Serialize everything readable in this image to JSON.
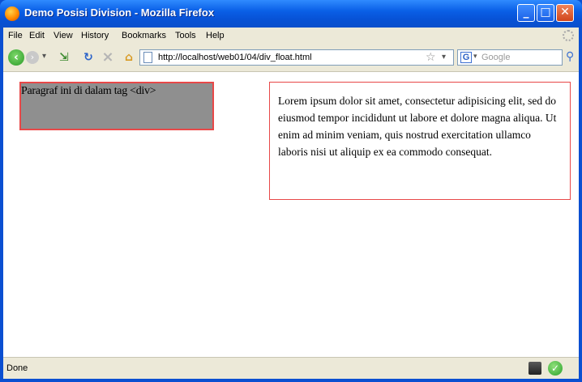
{
  "window": {
    "title": "Demo Posisi Division - Mozilla Firefox",
    "controls": {
      "minimize": "_",
      "maximize": "□",
      "close": "✕"
    }
  },
  "menu": [
    "File",
    "Edit",
    "View",
    "History",
    "Bookmarks",
    "Tools",
    "Help"
  ],
  "navbar": {
    "back_icon": "arrow-left-icon",
    "forward_icon": "arrow-right-icon",
    "url": "http://localhost/web01/04/div_float.html",
    "search_engine": "G",
    "search_placeholder": "Google"
  },
  "content": {
    "div_text": "Paragraf ini di dalam tag <div>",
    "paragraph_text": "Lorem ipsum dolor sit amet, consectetur adipisicing elit, sed do eiusmod tempor incididunt ut labore et dolore magna aliqua. Ut enim ad minim veniam, quis nostrud exercitation ullamco laboris nisi ut aliquip ex ea commodo consequat."
  },
  "status": {
    "text": "Done"
  },
  "colors": {
    "titlebar": "#0a5fe6",
    "box_border": "#e84848",
    "div_bg": "#8f8f8f"
  }
}
